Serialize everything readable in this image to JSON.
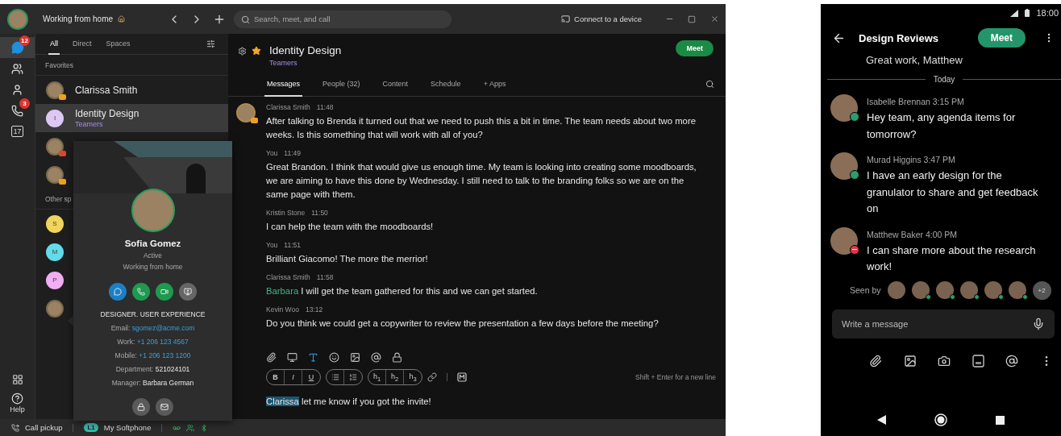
{
  "titlebar": {
    "status_text": "Working from home",
    "search_placeholder": "Search, meet, and call",
    "connect_label": "Connect to a device"
  },
  "rail": {
    "items": [
      {
        "kind": "chat",
        "badge": "12",
        "selected": true
      },
      {
        "kind": "teams",
        "selected": false
      },
      {
        "kind": "contacts",
        "selected": false
      },
      {
        "kind": "calls",
        "badge": "3",
        "selected": false
      },
      {
        "kind": "calendar",
        "label": "17",
        "selected": false
      }
    ],
    "help_label": "Help"
  },
  "list": {
    "tabs": [
      {
        "label": "All",
        "selected": true
      },
      {
        "label": "Direct",
        "selected": false
      },
      {
        "label": "Spaces",
        "selected": false
      }
    ],
    "sections": [
      {
        "title": "Favorites",
        "items": [
          {
            "kind": "photo",
            "name": "Clarissa Smith",
            "color": "#f0a020",
            "selected": false
          },
          {
            "kind": "letter",
            "initial": "I",
            "name": "Identity Design",
            "subtitle": "Teamers",
            "color": "#dcc8f2",
            "selected": true
          },
          {
            "kind": "photo",
            "color": "#e0452f",
            "selected": false
          },
          {
            "kind": "photo",
            "color": "#f0a020",
            "selected": false
          }
        ]
      },
      {
        "title": "Other sp",
        "items": [
          {
            "kind": "letter",
            "initial": "S",
            "color": "#f0d45c",
            "selected": false
          },
          {
            "kind": "letter",
            "initial": "M",
            "color": "#62dcea",
            "selected": false
          },
          {
            "kind": "letter",
            "initial": "P",
            "color": "#f2aef2",
            "selected": false
          },
          {
            "kind": "photo",
            "selected": false
          }
        ]
      }
    ]
  },
  "space": {
    "title": "Identity Design",
    "starred": true,
    "subtitle": "Teamers",
    "meet_label": "Meet",
    "tabs": [
      {
        "label": "Messages",
        "selected": true
      },
      {
        "label": "People (32)",
        "selected": false
      },
      {
        "label": "Content",
        "selected": false
      },
      {
        "label": "Schedule",
        "selected": false
      },
      {
        "label": "+ Apps",
        "selected": false
      }
    ],
    "messages": [
      {
        "sender": "Clarissa Smith",
        "time": "11:48",
        "avatar": true,
        "text": "After talking to Brenda it turned out that we need to push this a bit in time. The team needs about two more weeks. Is this something that will work with all of you?"
      },
      {
        "sender": "You",
        "time": "11:49",
        "avatar": false,
        "text": "Great Brandon. I think that would give us enough time. My team is looking into creating some moodboards, we are aiming to have this done by Wednesday. I still need to talk to the branding folks so we are on the same page with them."
      },
      {
        "sender": "Kristin Stone",
        "time": "11:50",
        "avatar": false,
        "text": "I can help the team with the moodboards!"
      },
      {
        "sender": "You",
        "time": "11:51",
        "avatar": false,
        "text": "Brilliant Giacomo! The more the merrior!"
      },
      {
        "sender": "Clarissa Smith",
        "time": "11:58",
        "avatar": false,
        "mention": "Barbara",
        "text": " I will get the team gathered for this and we can get started."
      },
      {
        "sender": "Kevin Woo",
        "time": "13:12",
        "avatar": false,
        "text": "Do you think we could get a copywriter to review the presentation a few days before the meeting?"
      }
    ],
    "composer": {
      "formatting_on": true,
      "format_groups": [
        [
          {
            "kind": "bold",
            "label": "B"
          },
          {
            "kind": "italic",
            "label": "I"
          },
          {
            "kind": "underline",
            "label": "U"
          }
        ],
        [
          {
            "kind": "bullets"
          },
          {
            "kind": "numbers"
          }
        ],
        [
          {
            "kind": "heading",
            "label": "h$_{1}$"
          },
          {
            "kind": "heading",
            "label": "h$_{2}$"
          },
          {
            "kind": "heading",
            "label": "h$_{3}$"
          }
        ]
      ],
      "hint": "Shift + Enter for a new line",
      "mention": "Clarissa",
      "text": " let me know if you got the invite!"
    }
  },
  "contact_card": {
    "name": "Sofia Gomez",
    "status": "Active",
    "status_message": "Working from home",
    "actions": [
      {
        "kind": "chat"
      },
      {
        "kind": "call"
      },
      {
        "kind": "video"
      },
      {
        "kind": "share"
      }
    ],
    "job_title": "DESIGNER. USER EXPERIENCE",
    "fields": [
      {
        "label": "Email:",
        "value": "sgomez@acme.com",
        "kind": "link"
      },
      {
        "label": "Work:",
        "value": "+1 206 123 4567",
        "kind": "link"
      },
      {
        "label": "Mobile:",
        "value": "+1 206 123 1200",
        "kind": "link"
      },
      {
        "label": "Department:",
        "value": "521024101",
        "kind": "plain"
      },
      {
        "label": "Manager:",
        "value": "Barbara German",
        "kind": "plain"
      }
    ],
    "footer_actions": [
      {
        "kind": "lock"
      },
      {
        "kind": "mail"
      }
    ]
  },
  "status_bar": {
    "call_pickup": "Call pickup",
    "line_badge": "L1",
    "line_label": "My Softphone"
  },
  "phone": {
    "time": "18:00",
    "title": "Design Reviews",
    "meet_label": "Meet",
    "previous_text": "Great work, Matthew",
    "divider": "Today",
    "messages": [
      {
        "meta": "Isabelle Brennan 3:15 PM",
        "text": "Hey team, any agenda items for tomorrow?",
        "color": "#2a9d6e",
        "dnd": false
      },
      {
        "meta": "Murad Higgins 3:47 PM",
        "text": "I have an early design for the granulator to share and get feedback on",
        "color": "#2a9d6e",
        "dnd": false
      },
      {
        "meta": "Matthew Baker 4:00 PM",
        "text": "I can share more about the research work!",
        "color": "#e0364a",
        "dnd": true
      }
    ],
    "seen_by_label": "Seen by",
    "seen_avatars": [
      {
        "online": false
      },
      {
        "online": true
      },
      {
        "online": true
      },
      {
        "online": true
      },
      {
        "online": true
      },
      {
        "online": true
      }
    ],
    "seen_more": "+2",
    "input_placeholder": "Write a message"
  }
}
